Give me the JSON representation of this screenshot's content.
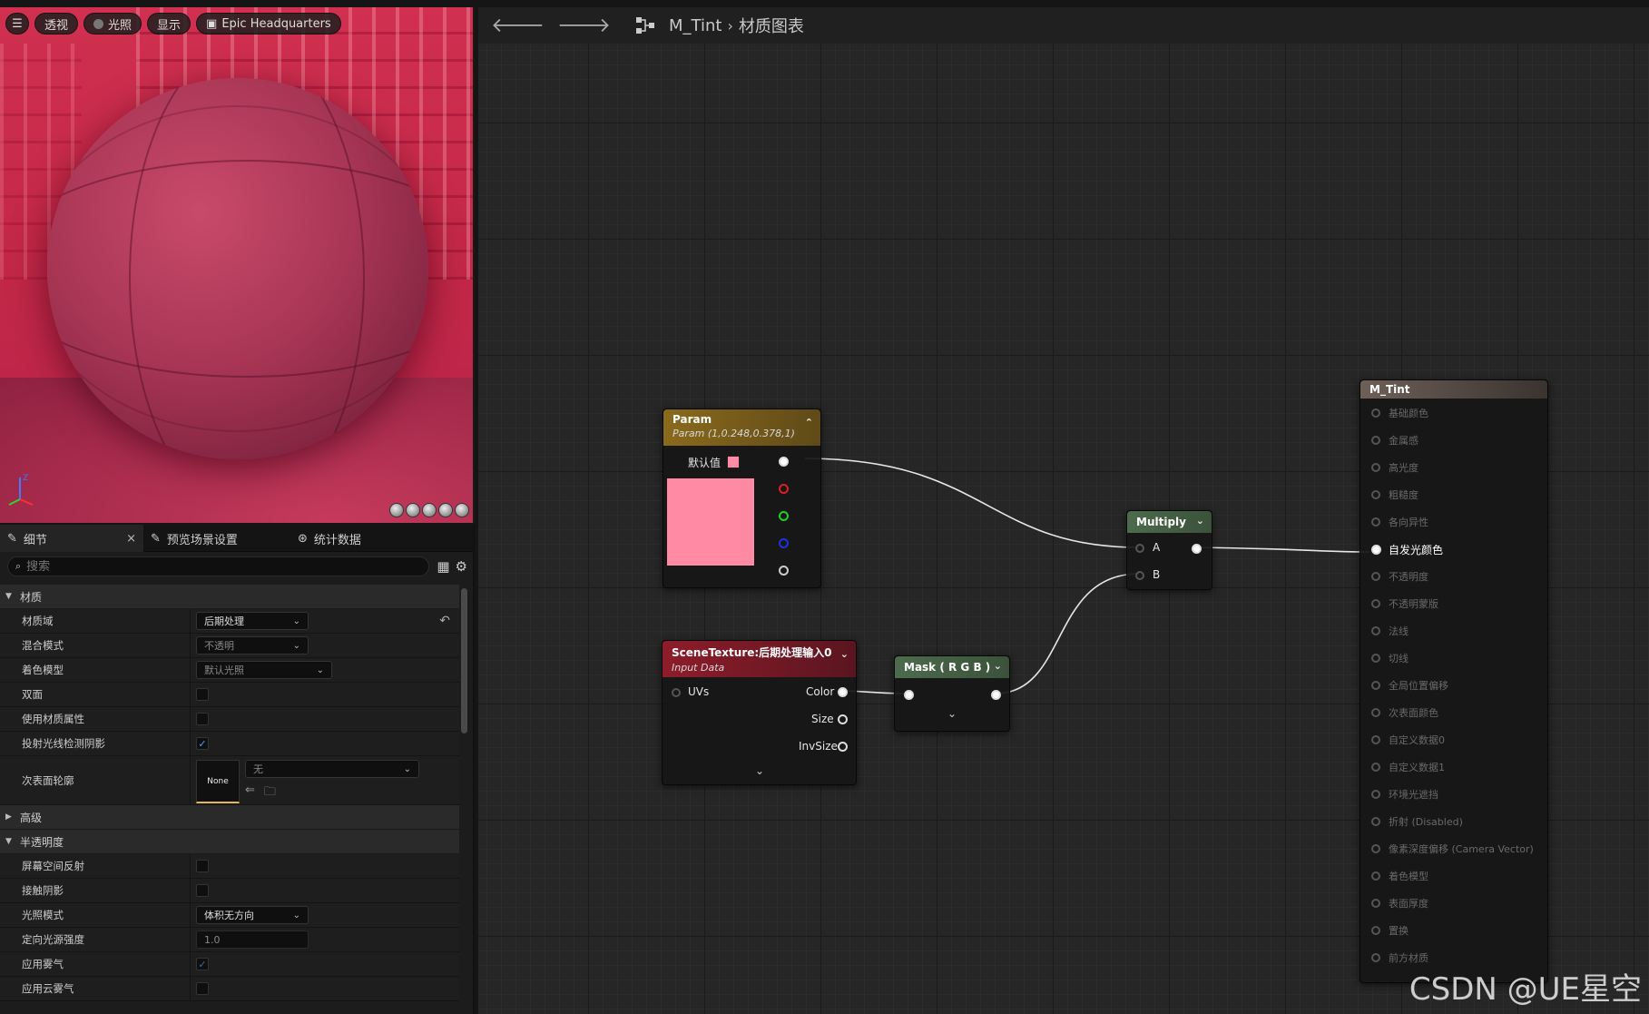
{
  "viewport": {
    "toolbar": {
      "perspective": "透视",
      "lighting": "光照",
      "show": "显示",
      "level": "Epic Headquarters"
    }
  },
  "details": {
    "tabs": [
      {
        "label": "细节",
        "icon": "pencil-icon"
      },
      {
        "label": "预览场景设置",
        "icon": "pencil-icon"
      },
      {
        "label": "统计数据",
        "icon": "stats-icon"
      }
    ],
    "search_placeholder": "搜索",
    "sections": {
      "material": {
        "title": "材质",
        "material_domain": {
          "label": "材质域",
          "value": "后期处理"
        },
        "blend_mode": {
          "label": "混合模式",
          "value": "不透明"
        },
        "shading_model": {
          "label": "着色模型",
          "value": "默认光照"
        },
        "two_sided": {
          "label": "双面",
          "checked": false
        },
        "use_material_attributes": {
          "label": "使用材质属性",
          "checked": false
        },
        "cast_ray_traced_shadows": {
          "label": "投射光线检测阴影",
          "checked": true
        },
        "subsurface_profile": {
          "label": "次表面轮廓",
          "thumb": "None",
          "value": "无"
        }
      },
      "advanced": {
        "title": "高级"
      },
      "translucency": {
        "title": "半透明度",
        "screen_space_reflections": {
          "label": "屏幕空间反射",
          "checked": false
        },
        "contact_shadows": {
          "label": "接触阴影",
          "checked": false
        },
        "lighting_mode": {
          "label": "光照模式",
          "value": "体积无方向"
        },
        "directional_light_intensity": {
          "label": "定向光源强度",
          "value": "1.0"
        },
        "apply_fogging": {
          "label": "应用雾气",
          "checked": true
        },
        "apply_cloud_fogging": {
          "label": "应用云雾气",
          "checked": false
        }
      }
    }
  },
  "graph": {
    "breadcrumb": {
      "asset": "M_Tint",
      "graph": "材质图表"
    },
    "nodes": {
      "param": {
        "title": "Param",
        "subtitle": "Param (1,0.248,0.378,1)",
        "default_label": "默认值",
        "color": "#ff8aa3",
        "outputs": [
          "rgba",
          "r",
          "g",
          "b",
          "a"
        ]
      },
      "scene_texture": {
        "title": "SceneTexture:后期处理输入0",
        "subtitle": "Input Data",
        "input": "UVs",
        "outputs": [
          "Color",
          "Size",
          "InvSize"
        ]
      },
      "mask": {
        "title": "Mask ( R G B )"
      },
      "multiply": {
        "title": "Multiply",
        "inputs": [
          "A",
          "B"
        ]
      },
      "result": {
        "title": "M_Tint",
        "active_input": "自发光颜色",
        "inputs": [
          "基础颜色",
          "金属感",
          "高光度",
          "粗糙度",
          "各向异性",
          "自发光颜色",
          "不透明度",
          "不透明蒙版",
          "法线",
          "切线",
          "全局位置偏移",
          "次表面颜色",
          "自定义数据0",
          "自定义数据1",
          "环境光遮挡",
          "折射 (Disabled)",
          "像素深度偏移 (Camera Vector)",
          "着色模型",
          "表面厚度",
          "置换",
          "前方材质"
        ]
      }
    },
    "watermark": "CSDN @UE星空"
  },
  "colors": {
    "param_header": "#8a6a1c",
    "scene_header": "#8e1d2a",
    "mask_header": "#4d6b4d",
    "multiply_header": "#4d6b4d",
    "result_header": "#6e6058",
    "checkbox": "#4aa3ff"
  }
}
